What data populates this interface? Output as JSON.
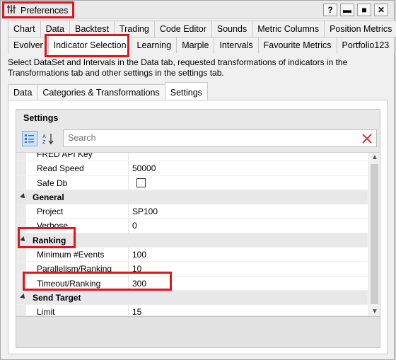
{
  "window": {
    "title": "Preferences",
    "buttons": {
      "help": "?",
      "minimize": "▬",
      "maximize": "■",
      "close": "✕"
    }
  },
  "tabs": {
    "row1": [
      "Chart",
      "Data",
      "Backtest",
      "Trading",
      "Code Editor",
      "Sounds",
      "Metric Columns",
      "Position Metrics"
    ],
    "row2": [
      "Evolver",
      "Indicator Selection",
      "Learning",
      "Marple",
      "Intervals",
      "Favourite Metrics",
      "Portfolio123"
    ],
    "active": "Indicator Selection"
  },
  "description": "Select DataSet and Intervals in the Data tab, requested transformations of indicators in the Transformations tab and other settings in the settings tab.",
  "subtabs": {
    "items": [
      "Data",
      "Categories & Transformations",
      "Settings"
    ],
    "active": "Settings"
  },
  "settings": {
    "title": "Settings",
    "search": {
      "placeholder": "Search",
      "value": ""
    },
    "rows": [
      {
        "type": "item",
        "name": "FRED API Key",
        "value": ""
      },
      {
        "type": "item",
        "name": "Read Speed",
        "value": "50000"
      },
      {
        "type": "check",
        "name": "Safe Db",
        "value": "false"
      },
      {
        "type": "category",
        "name": "General"
      },
      {
        "type": "item",
        "name": "Project",
        "value": "SP100"
      },
      {
        "type": "item",
        "name": "Verbose",
        "value": "0"
      },
      {
        "type": "category",
        "name": "Ranking"
      },
      {
        "type": "item",
        "name": "Minimum #Events",
        "value": "100"
      },
      {
        "type": "item",
        "name": "Parallelism/Ranking",
        "value": "10"
      },
      {
        "type": "item",
        "name": "Timeout/Ranking",
        "value": "300"
      },
      {
        "type": "category",
        "name": "Send Target"
      },
      {
        "type": "item",
        "name": "Limit",
        "value": "15"
      }
    ]
  },
  "colors": {
    "highlight": "#e0161f",
    "category_bg": "#e8e8e8",
    "search_clear": "#d9363e"
  },
  "icons": [
    "sliders-icon",
    "categorized-icon",
    "sort-az-icon",
    "clear-search-icon",
    "collapse-arrow-icon"
  ]
}
